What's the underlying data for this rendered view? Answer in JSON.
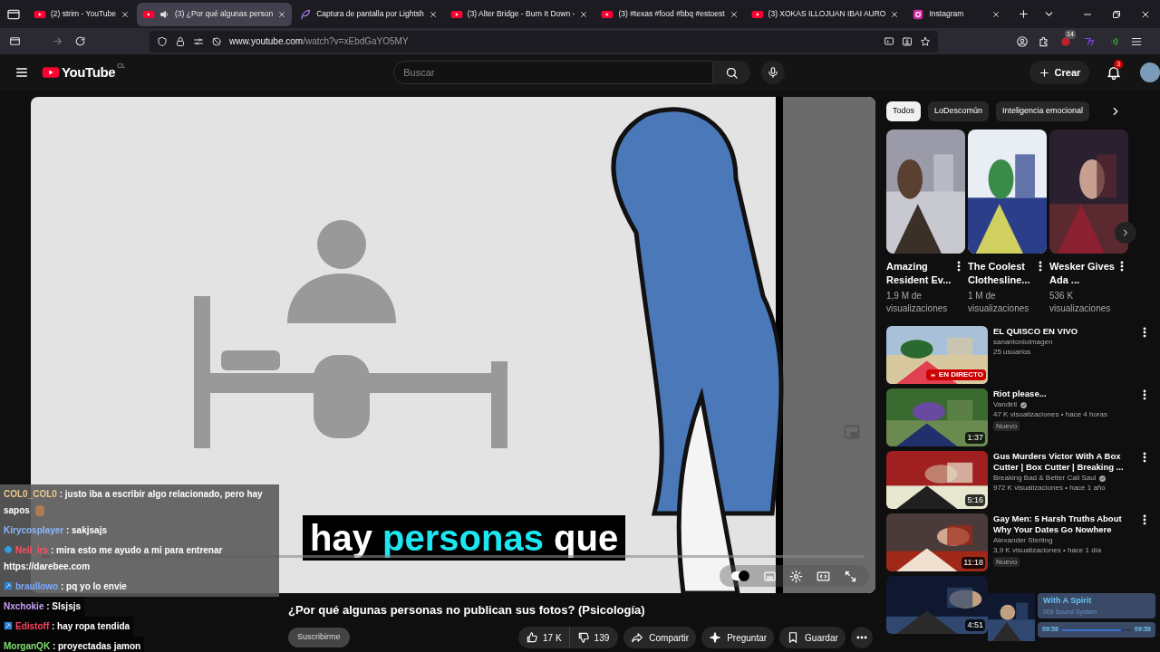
{
  "browser": {
    "tabs": [
      {
        "title": "(2) strim - YouTube",
        "kind": "youtube",
        "audio": false,
        "selected": false
      },
      {
        "title": "(3) ¿Por qué algunas person",
        "kind": "youtube",
        "audio": true,
        "selected": true
      },
      {
        "title": "Captura de pantalla por Lightsh",
        "kind": "feather",
        "audio": false,
        "selected": false
      },
      {
        "title": "(3) Alter Bridge - Burn It Down -",
        "kind": "youtube",
        "audio": false,
        "selected": false
      },
      {
        "title": "(3) #texas #food #bbq #estoest",
        "kind": "youtube",
        "audio": false,
        "selected": false
      },
      {
        "title": "(3) XOKAS ILLOJUAN IBAI AURO",
        "kind": "youtube",
        "audio": false,
        "selected": false
      },
      {
        "title": "Instagram",
        "kind": "instagram",
        "audio": false,
        "selected": false
      }
    ],
    "url_host": "www.youtube.com",
    "url_path": "/watch?v=xEbdGaYO5MY",
    "extension_badge": "14"
  },
  "header": {
    "logo": "YouTube",
    "region": "CL",
    "search": {
      "placeholder": "Buscar"
    },
    "create": "Crear",
    "notifications": "3"
  },
  "player": {
    "subtitle": [
      {
        "text": "hay",
        "highlight": false
      },
      {
        "text": "personas",
        "highlight": true
      },
      {
        "text": "que",
        "highlight": false
      }
    ],
    "level": 0.01,
    "autoplay": true
  },
  "chat": [
    {
      "user": "COL0_COL0",
      "color": "#e8c88a",
      "badge": false,
      "message": ": justo iba a escribir algo relacionado, pero hay sapos",
      "emote": true
    },
    {
      "user": "Kirycosplayer",
      "color": "#8ab8ff",
      "badge": false,
      "message": ": sakjsajs",
      "emote": false
    },
    {
      "user": "Neil_irs",
      "color": "#ff5068",
      "badge": true,
      "message": ": mira esto me ayudo a mi para entrenar https://darebee.com",
      "emote": false
    },
    {
      "user": "braullowo",
      "color": "#7aa8ff",
      "badge": true,
      "message": ": pq yo lo envie",
      "emote": false
    },
    {
      "user": "Nxchokie",
      "color": "#c8a0f8",
      "badge": false,
      "message": ": Slsjsjs",
      "emote": false
    },
    {
      "user": "Edistoff",
      "color": "#ff4060",
      "badge": true,
      "message": ": hay ropa tendida",
      "emote": false
    },
    {
      "user": "MorganQK",
      "color": "#80e070",
      "badge": false,
      "message": ": proyectadas jamon",
      "emote": false
    }
  ],
  "video": {
    "title": "¿Por qué algunas personas no publican sus fotos? (Psicología)",
    "subscribe": "Suscribirme",
    "likes": "17 K",
    "dislikes": "139",
    "share": "Compartir",
    "ask": "Preguntar",
    "save": "Guardar"
  },
  "sidebar": {
    "chips": [
      {
        "label": "Todos",
        "selected": true
      },
      {
        "label": "LoDescomún",
        "selected": false
      },
      {
        "label": "Inteligencia emocional",
        "selected": false
      }
    ],
    "shorts": [
      {
        "title": "Amazing Resident Ev...",
        "views": "1,9 M de visualizaciones"
      },
      {
        "title": "The Coolest Clothesline...",
        "views": "1 M de visualizaciones"
      },
      {
        "title": "Wesker Gives Ada ...",
        "views": "536 K visualizaciones"
      }
    ],
    "videos": [
      {
        "title": "EL QUISCO EN VIVO",
        "channel": "sanantonioimagen",
        "verified": false,
        "meta": "25 usuarios",
        "live": "EN DIRECTO"
      },
      {
        "title": "Riot please...",
        "channel": "Vandiril",
        "verified": true,
        "meta": "47 K visualizaciones • hace 4 horas",
        "badge": "Nuevo",
        "duration": "1:37"
      },
      {
        "title": "Gus Murders Victor With A Box Cutter | Box Cutter | Breaking ...",
        "channel": "Breaking Bad & Better Call Saul",
        "verified": true,
        "meta": "972 K visualizaciones • hace 1 año",
        "duration": "5:16"
      },
      {
        "title": "Gay Men: 5 Harsh Truths About Why Your Dates Go Nowhere",
        "channel": "Alexander Sterling",
        "verified": false,
        "meta": "3,9 K visualizaciones • hace 1 día",
        "badge": "Nuevo",
        "duration": "11:18"
      },
      {
        "duration": "4:51"
      }
    ]
  },
  "mini_player": {
    "title": "With A Spirit",
    "artist": "009 Sound System",
    "elapsed": "09:58",
    "total": "09:58",
    "level": 0.85
  }
}
